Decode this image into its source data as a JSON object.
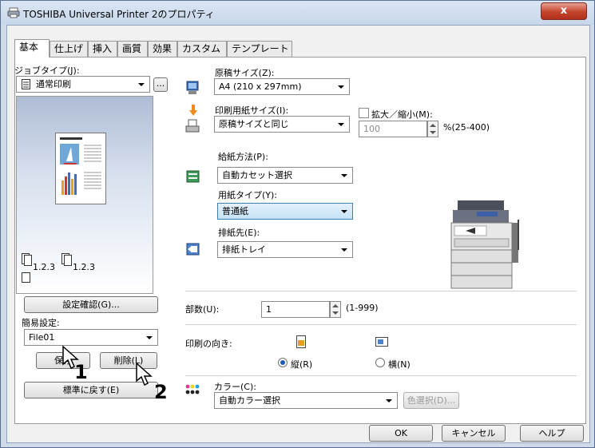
{
  "window": {
    "title": "TOSHIBA Universal Printer 2のプロパティ",
    "close_label": "x"
  },
  "tabs": [
    "基本",
    "仕上げ",
    "挿入",
    "画質",
    "効果",
    "カスタム",
    "テンプレート"
  ],
  "left": {
    "job_type_label": "ジョブタイプ(J):",
    "job_type_value": "通常印刷",
    "job_type_more": "...",
    "page_counter_a": "1.2.3",
    "page_counter_b": "1.2.3",
    "confirm_button": "設定確認(G)...",
    "easy_setting_label": "簡易設定:",
    "easy_setting_value": "File01",
    "save_button": "保存",
    "delete_button": "削除(L)",
    "reset_button": "標準に戻す(E)"
  },
  "paper": {
    "original_size_label": "原稿サイズ(Z):",
    "original_size_value": "A4 (210 x 297mm)",
    "print_paper_label": "印刷用紙サイズ(I):",
    "print_paper_value": "原稿サイズと同じ",
    "zoom_label": "拡大／縮小(M):",
    "zoom_value": "100",
    "zoom_range": "%(25-400)",
    "feed_label": "給紙方法(P):",
    "feed_value": "自動カセット選択",
    "type_label": "用紙タイプ(Y):",
    "type_value": "普通紙",
    "output_label": "排紙先(E):",
    "output_value": "排紙トレイ"
  },
  "copies": {
    "label": "部数(U):",
    "value": "1",
    "range": "(1-999)"
  },
  "orientation": {
    "label": "印刷の向き:",
    "portrait": "縦(R)",
    "landscape": "横(N)",
    "selected": "portrait"
  },
  "color": {
    "label": "カラー(C):",
    "value": "自動カラー選択",
    "select_button": "色選択(D)..."
  },
  "footer": {
    "ok": "OK",
    "cancel": "キャンセル",
    "help": "ヘルプ"
  },
  "callouts": {
    "one": "1",
    "two": "2"
  }
}
